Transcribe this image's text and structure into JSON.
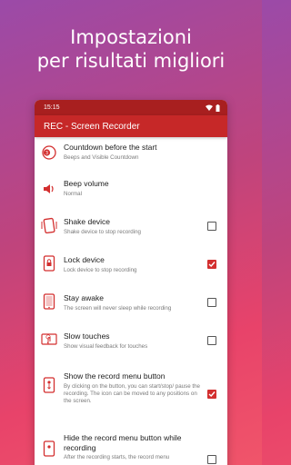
{
  "headline": [
    "Impostazioni",
    "per risultati migliori"
  ],
  "status_time": "15:15",
  "app_title": "REC - Screen Recorder",
  "colors": {
    "accent": "#c62828",
    "status": "#a81f1f",
    "checked": "#d32f2f"
  },
  "settings": [
    {
      "title": "Countdown before the start",
      "sub": "Beeps and Visible Countdown",
      "icon": "countdown-icon",
      "checkbox": null
    },
    {
      "title": "Beep volume",
      "sub": "Normal",
      "icon": "volume-icon",
      "checkbox": null
    },
    {
      "title": "Shake device",
      "sub": "Shake device to stop recording",
      "icon": "shake-icon",
      "checkbox": false
    },
    {
      "title": "Lock device",
      "sub": "Lock device to stop recording",
      "icon": "lock-icon",
      "checkbox": true
    },
    {
      "title": "Stay awake",
      "sub": "The screen will never sleep while recording",
      "icon": "stay-awake-icon",
      "checkbox": false
    },
    {
      "title": "Slow touches",
      "sub": "Show visual feedback for touches",
      "icon": "touch-icon",
      "checkbox": false
    },
    {
      "title": "Show the record menu button",
      "sub": "By clicking on the button, you can start/stop/ pause the recording. The icon can be moved to any positions on the screen.",
      "icon": "record-button-icon",
      "checkbox": true
    },
    {
      "title": "Hide the record menu button while recording",
      "sub": "After the recording starts, the record menu",
      "icon": "hide-button-icon",
      "checkbox": false
    }
  ]
}
